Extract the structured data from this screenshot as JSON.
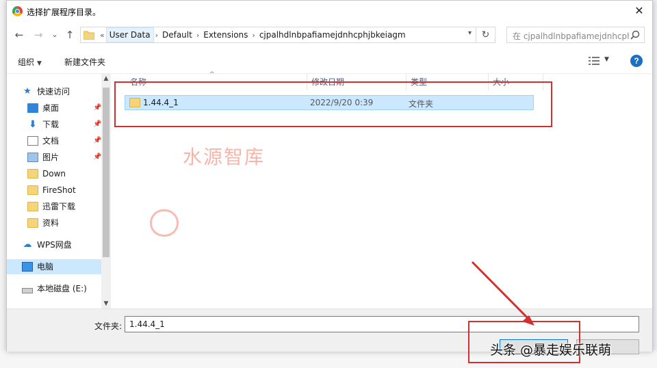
{
  "dialog": {
    "title": "选择扩展程序目录。",
    "close_glyph": "✕"
  },
  "nav": {
    "back_glyph": "←",
    "forward_glyph": "→",
    "recent_glyph": "⌄",
    "up_glyph": "↑",
    "crumb_prefix": "«",
    "breadcrumbs": [
      "User Data",
      "Default",
      "Extensions",
      "cjpalhdlnbpafiamejdnhcphjbkeiagm"
    ],
    "refresh_glyph": "↻",
    "search_placeholder": "在 cjpalhdlnbpafiamejdnhcphjbkeiagm 中搜索"
  },
  "toolbar": {
    "organize": "组织",
    "new_folder": "新建文件夹",
    "help": "?"
  },
  "sidebar": {
    "items": [
      {
        "label": "快速访问",
        "icon": "star-icon"
      },
      {
        "label": "桌面",
        "icon": "desktop-icon",
        "pinned": true
      },
      {
        "label": "下载",
        "icon": "download-icon",
        "pinned": true
      },
      {
        "label": "文档",
        "icon": "document-icon",
        "pinned": true
      },
      {
        "label": "图片",
        "icon": "picture-icon",
        "pinned": true
      },
      {
        "label": "Down",
        "icon": "folder-icon"
      },
      {
        "label": "FireShot",
        "icon": "folder-icon"
      },
      {
        "label": "迅雷下载",
        "icon": "folder-icon"
      },
      {
        "label": "资料",
        "icon": "folder-icon"
      },
      {
        "label": "WPS网盘",
        "icon": "cloud-icon"
      },
      {
        "label": "电脑",
        "icon": "computer-icon"
      },
      {
        "label": "本地磁盘 (E:)",
        "icon": "drive-icon"
      }
    ]
  },
  "columns": [
    "名称",
    "修改日期",
    "类型",
    "大小"
  ],
  "files": [
    {
      "name": "1.44.4_1",
      "modified": "2022/9/20 0:39",
      "type": "文件夹",
      "size": ""
    }
  ],
  "footer": {
    "folder_label": "文件夹:",
    "folder_value": "1.44.4_1"
  },
  "overlays": {
    "watermark": "水源智库",
    "credit": "头条 @暴走娱乐联萌"
  },
  "colors": {
    "highlight": "#d32f2f",
    "selection": "#cce8ff",
    "accent": "#0078d7"
  }
}
